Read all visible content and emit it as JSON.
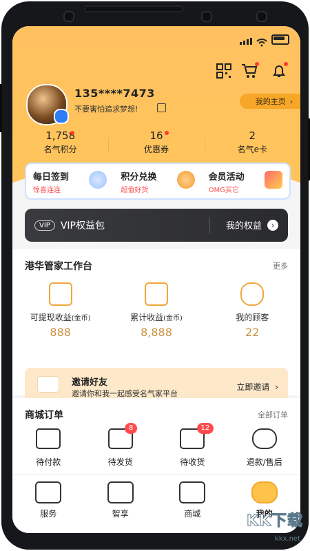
{
  "header": {
    "phone_masked": "135****7473",
    "motto": "不要害怕追求梦想!",
    "homepage_button": "我的主页",
    "stats": [
      {
        "value": "1,758",
        "label": "名气积分"
      },
      {
        "value": "16",
        "label": "优惠券"
      },
      {
        "value": "2",
        "label": "名气e卡"
      }
    ]
  },
  "quick_actions": [
    {
      "title": "每日签到",
      "subtitle": "惊喜连连"
    },
    {
      "title": "积分兑换",
      "subtitle": "超值好货"
    },
    {
      "title": "会员活动",
      "subtitle": "OMG买它"
    }
  ],
  "vip_banner": {
    "tag": "VIP",
    "title": "VIP权益包",
    "right_label": "我的权益"
  },
  "workstation": {
    "title": "港华管家工作台",
    "more": "更多",
    "items": [
      {
        "label": "可提现收益",
        "unit": "(金币)",
        "value": "888"
      },
      {
        "label": "累计收益",
        "unit": "(金币)",
        "value": "8,888"
      },
      {
        "label": "我的顾客",
        "unit": "",
        "value": "22"
      }
    ],
    "invite": {
      "title": "邀请好友",
      "desc": "邀请你和我一起感受名气家平台",
      "cta": "立即邀请"
    }
  },
  "mall_orders": {
    "title": "商城订单",
    "all": "全部订单",
    "items": [
      {
        "label": "待付款",
        "badge": ""
      },
      {
        "label": "待发货",
        "badge": "8"
      },
      {
        "label": "待收货",
        "badge": "12"
      },
      {
        "label": "退款/售后",
        "badge": ""
      }
    ]
  },
  "tabbar": [
    {
      "label": "服务",
      "icon": "home-icon",
      "active": false
    },
    {
      "label": "智享",
      "icon": "wifi-icon",
      "active": false
    },
    {
      "label": "商城",
      "icon": "bag-icon",
      "active": false
    },
    {
      "label": "我的",
      "icon": "user-icon",
      "active": true
    }
  ],
  "watermark": {
    "text": "KK下载",
    "sub": "kkx.net"
  },
  "colors": {
    "header_yellow": "#ffc45b",
    "accent_orange": "#f6a728",
    "badge_red": "#ff4d4f",
    "dark_vip": "#2f3034"
  }
}
